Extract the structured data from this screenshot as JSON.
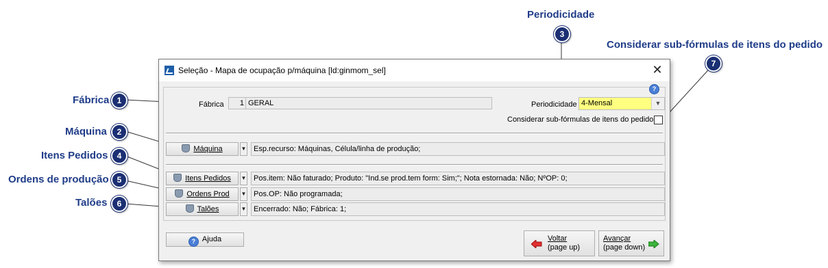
{
  "callouts": [
    {
      "num": "1",
      "label": "Fábrica"
    },
    {
      "num": "2",
      "label": "Máquina"
    },
    {
      "num": "3",
      "label": "Periodicidade"
    },
    {
      "num": "4",
      "label": "Itens Pedidos"
    },
    {
      "num": "5",
      "label": "Ordens de produção"
    },
    {
      "num": "6",
      "label": "Talões"
    },
    {
      "num": "7",
      "label": "Considerar sub-fórmulas de itens do pedido"
    }
  ],
  "window": {
    "title": "Seleção - Mapa de ocupação p/máquina [ld:ginmom_sel]",
    "close_glyph": "✕",
    "help_glyph": "?"
  },
  "form": {
    "fabrica_label": "Fábrica",
    "fabrica_code": "1",
    "fabrica_name": "GERAL",
    "periodicidade_label": "Periodicidade",
    "periodicidade_value": "4-Mensal",
    "considerar_label": "Considerar sub-fórmulas de itens do pedido",
    "considerar_checked": false
  },
  "filters": [
    {
      "button": "Máquina",
      "text": "Esp.recurso: Máquinas, Célula/linha de produção;"
    },
    {
      "button": "Itens Pedidos",
      "text": "Pos.item: Não faturado; Produto: \"Ind.se prod.tem form: Sim;\"; Nota estornada: Não; NºOP: 0;"
    },
    {
      "button": "Ordens Prod",
      "text": "Pos.OP: Não programada;"
    },
    {
      "button": "Talões",
      "text": "Encerrado: Não; Fábrica: 1;"
    }
  ],
  "footer": {
    "ajuda": "Ajuda",
    "voltar_line1": "Voltar",
    "voltar_line2": "(page up)",
    "avancar_line1": "Avançar",
    "avancar_line2": "(page down)"
  },
  "colors": {
    "callout": "#1f3c88",
    "badge": "#1b2f73",
    "combo_bg": "#ffff80"
  }
}
